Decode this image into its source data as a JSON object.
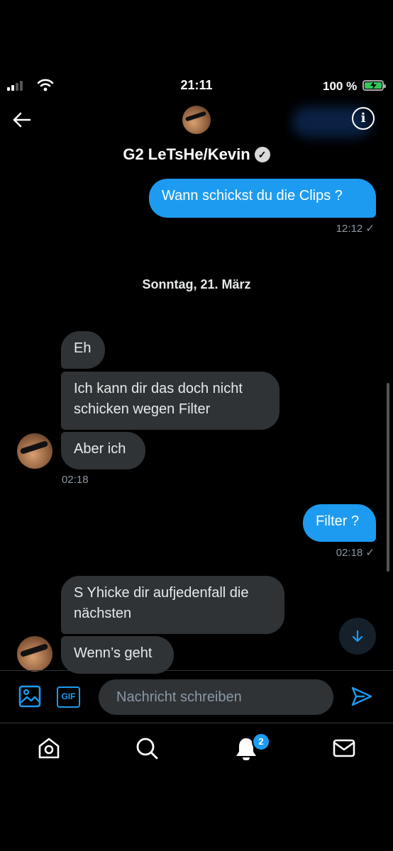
{
  "status_bar": {
    "time": "21:11",
    "battery": "100 %"
  },
  "header": {
    "name": "G2 LeTsHe/Kevin"
  },
  "messages": {
    "m1": {
      "text": "Wann schickst du die Clips ?",
      "time": "12:12 ✓"
    },
    "date_separator": "Sonntag, 21. März",
    "m2": {
      "text": "Eh"
    },
    "m3": {
      "text": "Ich kann dir das doch nicht schicken wegen Filter"
    },
    "m4": {
      "text": "Aber ich",
      "time": "02:18"
    },
    "m5": {
      "text": "Filter ?",
      "time": "02:18 ✓"
    },
    "m6": {
      "text": "S Yhicke dir aufjedenfall die nächsten"
    },
    "m7": {
      "text": "Wenn’s geht"
    }
  },
  "composer": {
    "placeholder": "Nachricht schreiben",
    "gif_label": "GIF"
  },
  "tabbar": {
    "notifications_badge": "2"
  },
  "colors": {
    "accent": "#1d9bf0",
    "incoming_bubble": "#2f3336",
    "background": "#000000"
  }
}
